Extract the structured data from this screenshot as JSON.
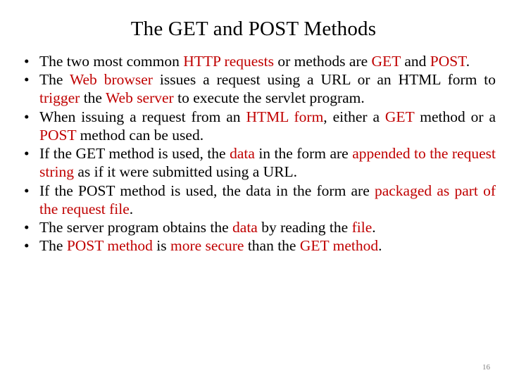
{
  "slide": {
    "title": "The GET and POST Methods",
    "page_number": "16",
    "accent_color": "#c00000",
    "bullets": [
      {
        "id": "bullet-1",
        "parts": [
          {
            "t": "The  two  most  common  ",
            "c": "black"
          },
          {
            "t": "HTTP  requests",
            "c": "red"
          },
          {
            "t": "  or  methods  are ",
            "c": "black"
          },
          {
            "t": "GET",
            "c": "red"
          },
          {
            "t": " and ",
            "c": "black"
          },
          {
            "t": "POST",
            "c": "red"
          },
          {
            "t": ".",
            "c": "black"
          }
        ]
      },
      {
        "id": "bullet-2",
        "parts": [
          {
            "t": "The  ",
            "c": "black"
          },
          {
            "t": "Web  browser",
            "c": "red"
          },
          {
            "t": "  issues  a  request  using  a  URL  or  an  HTML  form  to  ",
            "c": "black"
          },
          {
            "t": "trigger",
            "c": "red"
          },
          {
            "t": "  the  ",
            "c": "black"
          },
          {
            "t": "Web  server",
            "c": "red"
          },
          {
            "t": "  to  execute  the  servlet program.",
            "c": "black"
          }
        ]
      },
      {
        "id": "bullet-3",
        "parts": [
          {
            "t": "When issuing a request from an ",
            "c": "black"
          },
          {
            "t": "HTML form",
            "c": "red"
          },
          {
            "t": ", either a ",
            "c": "black"
          },
          {
            "t": "GET",
            "c": "red"
          },
          {
            "t": " method or a ",
            "c": "black"
          },
          {
            "t": "POST",
            "c": "red"
          },
          {
            "t": " method can be used.",
            "c": "black"
          }
        ]
      },
      {
        "id": "bullet-4",
        "parts": [
          {
            "t": "If  the  GET  method  is  used,  the  ",
            "c": "black"
          },
          {
            "t": "data",
            "c": "red"
          },
          {
            "t": "  in  the  form  are  ",
            "c": "black"
          },
          {
            "t": "appended  to  the  request  string",
            "c": "red"
          },
          {
            "t": "  as  if  it  were  submitted  using  a URL.",
            "c": "black"
          }
        ]
      },
      {
        "id": "bullet-5",
        "parts": [
          {
            "t": "If  the  POST  method  is  used,  the  data  in  the  form  are  ",
            "c": "black"
          },
          {
            "t": "packaged as part of the request file",
            "c": "red"
          },
          {
            "t": ".",
            "c": "black"
          }
        ]
      },
      {
        "id": "bullet-6",
        "parts": [
          {
            "t": "The server program obtains the ",
            "c": "black"
          },
          {
            "t": "data",
            "c": "red"
          },
          {
            "t": " by reading the ",
            "c": "black"
          },
          {
            "t": "file",
            "c": "red"
          },
          {
            "t": ".",
            "c": "black"
          }
        ]
      },
      {
        "id": "bullet-7",
        "parts": [
          {
            "t": "The ",
            "c": "black"
          },
          {
            "t": "POST method",
            "c": "red"
          },
          {
            "t": " is ",
            "c": "black"
          },
          {
            "t": "more secure",
            "c": "red"
          },
          {
            "t": " than the ",
            "c": "black"
          },
          {
            "t": "GET method",
            "c": "red"
          },
          {
            "t": ".",
            "c": "black"
          }
        ]
      }
    ]
  }
}
